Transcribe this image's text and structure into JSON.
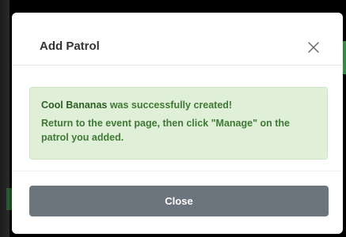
{
  "modal": {
    "title": "Add Patrol",
    "close_icon": "close-x-icon",
    "alert": {
      "patrol_name": "Cool Bananas",
      "created_text": " was successfully created!",
      "instructions": "Return to the event page, then click \"Manage\" on the patrol you added."
    },
    "close_button_label": "Close"
  },
  "colors": {
    "alert_background": "#e0efd8",
    "alert_text": "#3e7a33",
    "close_button": "#6c757d",
    "backdrop": "#000000"
  }
}
